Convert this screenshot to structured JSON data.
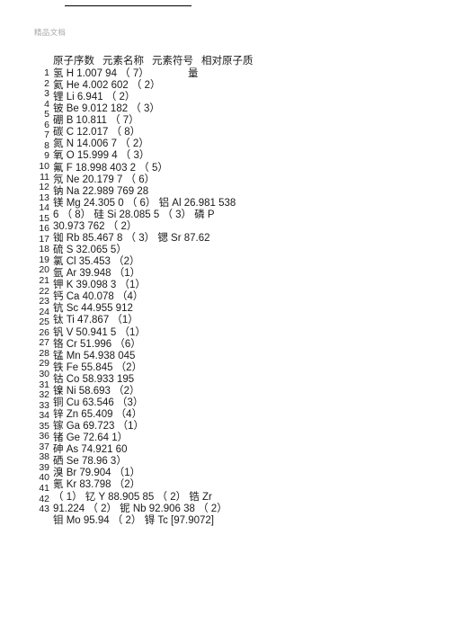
{
  "document": {
    "watermark": "精品文档",
    "rule": "horizontal-rule"
  },
  "table": {
    "headers": [
      "原子序数",
      "元素名称",
      "元素符号",
      "相对原子质"
    ],
    "header_overflow": "量"
  },
  "gutter": {
    "numbers": [
      "1",
      "2",
      "3",
      "4",
      "5",
      "6",
      "7",
      "8",
      "9",
      "10",
      "11",
      "12",
      "13",
      "14",
      "15",
      "16",
      "17",
      "18",
      "19",
      "20",
      "21",
      "22",
      "23",
      "24",
      "25",
      "26",
      "27",
      "28",
      "29",
      "30",
      "31",
      "32",
      "33",
      "34",
      "35",
      "36",
      "37",
      "38",
      "39",
      "40",
      "41",
      "42",
      "43"
    ]
  },
  "lines": [
    "氢 H 1.007 94 （ 7）",
    "氦 He 4.002 602 （ 2）",
    "锂 Li 6.941 （ 2）",
    "铍 Be 9.012 182 （ 3）",
    "硼 B 10.811 （ 7）",
    "碳 C 12.017 （ 8）",
    "氮 N 14.006 7 （ 2）",
    "氧 O 15.999 4 （ 3）",
    "氟 F 18.998 403 2 （ 5）",
    "氖 Ne 20.179 7 （ 6）",
    "钠 Na 22.989 769 28",
    "镁 Mg 24.305 0 （ 6） 铝 Al 26.981 538",
    "6 （ 8） 硅 Si 28.085 5 （ 3） 磷 P",
    "30.973 762 （ 2）",
    "铷 Rb 85.467 8 （ 3） 锶 Sr 87.62",
    "硫 S 32.065 5）",
    "氯 Cl 35.453 （2）",
    "氩 Ar 39.948 （1）",
    "钾 K 39.098 3 （1）",
    "钙 Ca 40.078 （4）",
    "钪 Sc 44.955 912",
    "钛 Ti 47.867 （1）",
    "钒 V 50.941 5 （1）",
    "铬 Cr 51.996 （6）",
    "锰 Mn 54.938 045",
    "铁 Fe 55.845 （2）",
    "钴 Co 58.933 195",
    "镍 Ni 58.693 （2）",
    "铜 Cu 63.546 （3）",
    "锌 Zn 65.409 （4）",
    "镓 Ga 69.723 （1）",
    "锗 Ge 72.64 1）",
    "砷 As 74.921 60",
    "硒 Se 78.96 3）",
    "溴 Br 79.904 （1）",
    "氪 Kr 83.798 （2）",
    "（ 1） 钇 Y 88.905 85 （ 2） 锆 Zr",
    "91.224 （ 2） 铌 Nb 92.906 38 （ 2）",
    "钼 Mo 95.94 （ 2） 锝 Tc [97.9072]"
  ]
}
